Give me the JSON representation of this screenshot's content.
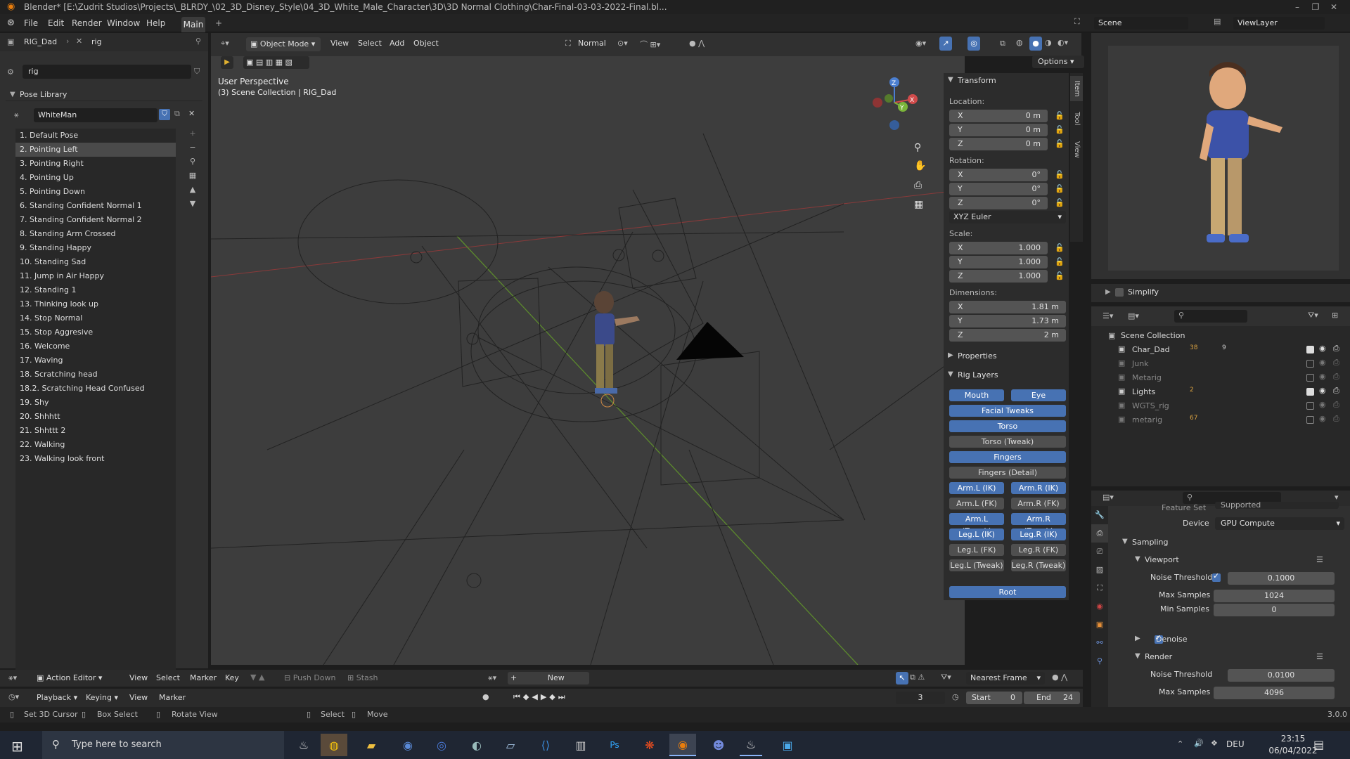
{
  "window": {
    "title": "Blender* [E:\\Zudrit Studios\\Projects\\_BLRDY_\\02_3D_Disney_Style\\04_3D_White_Male_Character\\3D\\3D Normal Clothing\\Char-Final-03-03-2022-Final.bl..."
  },
  "menu": [
    "File",
    "Edit",
    "Render",
    "Window",
    "Help"
  ],
  "workspace_tab": "Main",
  "scene": {
    "label": "Scene",
    "view_layer": "ViewLayer"
  },
  "left_panel": {
    "object_name": "RIG_Dad",
    "armature_name": "rig",
    "search_value": "rig",
    "section_title": "Pose Library",
    "library_name": "WhiteMan",
    "poses": [
      "1. Default Pose",
      "2. Pointing Left",
      "3. Pointing Right",
      "4. Pointing Up",
      "5. Pointing Down",
      "6. Standing Confident Normal 1",
      "7. Standing Confident Normal 2",
      "8. Standing Arm Crossed",
      "9. Standing Happy",
      "10. Standing Sad",
      "11. Jump in Air Happy",
      "12. Standing 1",
      "13. Thinking look up",
      "14. Stop Normal",
      "15. Stop Aggresive",
      "16. Welcome",
      "17. Waving",
      "18. Scratching head",
      "18.2. Scratching Head Confused",
      "19. Shy",
      "20. Shhhtt",
      "21. Shhttt 2",
      "22. Walking",
      "23. Walking look front"
    ],
    "selected_index": 1
  },
  "viewport": {
    "mode": "Object Mode",
    "menus": [
      "View",
      "Select",
      "Add",
      "Object"
    ],
    "orientation": "Normal",
    "options_label": "Options",
    "perspective": "User Perspective",
    "collection_info": "(3) Scene Collection | RIG_Dad",
    "side_tabs": [
      "Item",
      "Tool",
      "View"
    ]
  },
  "transform": {
    "title": "Transform",
    "location_label": "Location:",
    "location": [
      {
        "axis": "X",
        "value": "0 m"
      },
      {
        "axis": "Y",
        "value": "0 m"
      },
      {
        "axis": "Z",
        "value": "0 m"
      }
    ],
    "rotation_label": "Rotation:",
    "rotation": [
      {
        "axis": "X",
        "value": "0°"
      },
      {
        "axis": "Y",
        "value": "0°"
      },
      {
        "axis": "Z",
        "value": "0°"
      }
    ],
    "rotation_mode": "XYZ Euler",
    "scale_label": "Scale:",
    "scale": [
      {
        "axis": "X",
        "value": "1.000"
      },
      {
        "axis": "Y",
        "value": "1.000"
      },
      {
        "axis": "Z",
        "value": "1.000"
      }
    ],
    "dimensions_label": "Dimensions:",
    "dimensions": [
      {
        "axis": "X",
        "value": "1.81 m"
      },
      {
        "axis": "Y",
        "value": "1.73 m"
      },
      {
        "axis": "Z",
        "value": "2 m"
      }
    ],
    "properties_label": "Properties",
    "rig_layers_label": "Rig Layers"
  },
  "rig_layers": {
    "mouth": "Mouth",
    "eye": "Eye",
    "facial_tweaks": "Facial Tweaks",
    "torso": "Torso",
    "torso_tweak": "Torso (Tweak)",
    "fingers": "Fingers",
    "fingers_detail": "Fingers (Detail)",
    "arm_l_ik": "Arm.L (IK)",
    "arm_r_ik": "Arm.R (IK)",
    "arm_l_fk": "Arm.L (FK)",
    "arm_r_fk": "Arm.R (FK)",
    "arm_l_tweak": "Arm.L (Tweak)",
    "arm_r_tweak": "Arm.R (Tweak)",
    "leg_l_ik": "Leg.L (IK)",
    "leg_r_ik": "Leg.R (IK)",
    "leg_l_fk": "Leg.L (FK)",
    "leg_r_fk": "Leg.R (FK)",
    "leg_l_tweak": "Leg.L (Tweak)",
    "leg_r_tweak": "Leg.R (Tweak)",
    "root": "Root"
  },
  "outliner": {
    "simplify": "Simplify",
    "scene_collection": "Scene Collection",
    "items": [
      {
        "name": "Char_Dad",
        "count_a": "38",
        "count_b": "9",
        "checked": true,
        "dim": false
      },
      {
        "name": "Junk",
        "checked": false,
        "dim": true
      },
      {
        "name": "Metarig",
        "checked": false,
        "dim": true
      },
      {
        "name": "Lights",
        "count_a": "2",
        "checked": true,
        "dim": false
      },
      {
        "name": "WGTS_rig",
        "checked": false,
        "dim": true
      },
      {
        "name": "metarig",
        "count_a": "67",
        "checked": false,
        "dim": true
      }
    ]
  },
  "properties": {
    "feature_set_label": "Feature Set",
    "feature_set": "Supported",
    "device_label": "Device",
    "device": "GPU Compute",
    "sampling": "Sampling",
    "viewport": "Viewport",
    "noise_threshold_label": "Noise Threshold",
    "viewport_noise": "0.1000",
    "max_samples_label": "Max Samples",
    "viewport_max_samples": "1024",
    "min_samples_label": "Min Samples",
    "viewport_min_samples": "0",
    "denoise": "Denoise",
    "render": "Render",
    "render_noise": "0.0100",
    "render_max_samples": "4096"
  },
  "timeline": {
    "editor": "Action Editor",
    "menus": [
      "View",
      "Select",
      "Marker",
      "Key"
    ],
    "push_down": "Push Down",
    "stash": "Stash",
    "new": "New",
    "interpolation": "Nearest Frame",
    "menus2": [
      "Playback",
      "Keying",
      "View",
      "Marker"
    ],
    "current_frame": "3",
    "start_label": "Start",
    "start": "0",
    "end_label": "End",
    "end": "24"
  },
  "statusbar": {
    "set_cursor": "Set 3D Cursor",
    "box_select": "Box Select",
    "rotate_view": "Rotate View",
    "select": "Select",
    "move": "Move",
    "version": "3.0.0"
  },
  "taskbar": {
    "search_placeholder": "Type here to search",
    "language": "DEU",
    "time": "23:15",
    "date": "06/04/2022"
  },
  "colors": {
    "accent": "#4772b3",
    "bg": "#303030",
    "viewport": "#3d3d3d"
  }
}
